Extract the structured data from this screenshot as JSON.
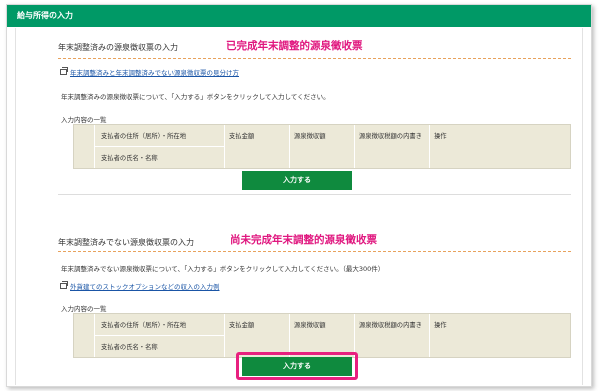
{
  "titlebar": {
    "title": "給与所得の入力"
  },
  "section1": {
    "heading": "年末調整済みの源泉徴収票の入力",
    "annotation": "已完成年末調整的源泉徵收票",
    "link": "年末調整済みと年末調整済みでない源泉徴収票の見分け方",
    "instruction": "年末調整済みの源泉徴収票について、「入力する」ボタンをクリックして入力してください。",
    "list_caption": "入力内容の一覧",
    "columns": {
      "payer_address": "支払者の住所（居所）・所在地",
      "payer_name": "支払者の氏名・名称",
      "amount": "支払金額",
      "withholding": "源泉徴収額",
      "breakdown": "源泉徴収税額の内書き",
      "action": "操作"
    },
    "button": "入力する"
  },
  "section2": {
    "heading": "年末調整済みでない源泉徴収票の入力",
    "annotation": "尚未完成年末調整的源泉徵收票",
    "instruction": "年末調整済みでない源泉徴収票について、「入力する」ボタンをクリックして入力してください。（最大300件）",
    "link": "外貨建てのストックオプションなどの収入の入力例",
    "list_caption": "入力内容の一覧",
    "columns": {
      "payer_address": "支払者の住所（居所）・所在地",
      "payer_name": "支払者の氏名・名称",
      "amount": "支払金額",
      "withholding": "源泉徴収額",
      "breakdown": "源泉徴収税額の内書き",
      "action": "操作"
    },
    "button": "入力する"
  },
  "colors": {
    "header_green": "#009966",
    "button_green": "#0f8a3e",
    "annotation_pink": "#e0177f",
    "highlight_pink": "#e8207f"
  }
}
